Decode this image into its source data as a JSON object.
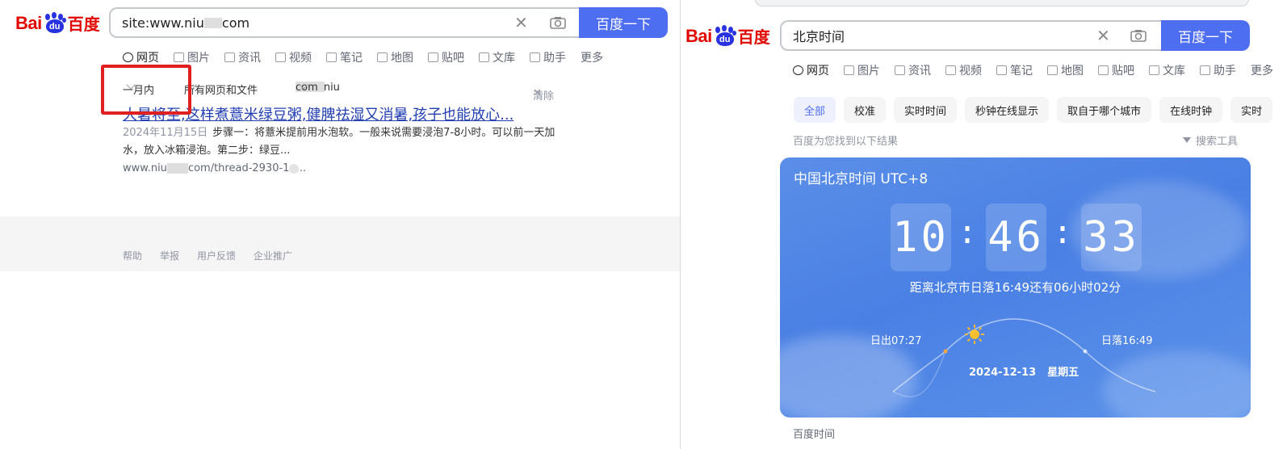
{
  "left": {
    "logo": {
      "latin": "Bai",
      "paw": "du",
      "cn": "百度"
    },
    "search": {
      "query": "site:www.niu",
      "query_tail": "com",
      "button": "百度一下"
    },
    "tabs": [
      "网页",
      "图片",
      "资讯",
      "视频",
      "笔记",
      "地图",
      "贴吧",
      "文库",
      "助手",
      "更多"
    ],
    "filters": {
      "time": "一月内",
      "scope": "所有网页和文件",
      "site": "www.niu",
      "site_tail": "com",
      "clear": "清除"
    },
    "result": {
      "title": "大暑将至,这样煮薏米绿豆粥,健脾祛湿又消暑,孩子也能放心...",
      "date": "2024年11月15日",
      "snippet": "步骤一：将薏米提前用水泡软。一般来说需要浸泡7-8小时。可以前一天加水，放入冰箱浸泡。第二步：绿豆...",
      "url_head": "www.niu",
      "url_tail": "com/thread-2930-1....."
    },
    "footer": [
      "帮助",
      "举报",
      "用户反馈",
      "企业推广"
    ]
  },
  "right": {
    "logo": {
      "latin": "Bai",
      "paw": "du",
      "cn": "百度"
    },
    "search": {
      "query": "北京时间",
      "button": "百度一下"
    },
    "tabs": [
      "网页",
      "图片",
      "资讯",
      "视频",
      "笔记",
      "地图",
      "贴吧",
      "文库",
      "助手",
      "更多"
    ],
    "chips": [
      "全部",
      "校准",
      "实时时间",
      "秒钟在线显示",
      "取自于哪个城市",
      "在线时钟",
      "实时"
    ],
    "found_text": "百度为您找到以下结果",
    "tools": "搜索工具",
    "card": {
      "title": "中国北京时间 UTC+8",
      "hours": "10",
      "minutes": "46",
      "seconds": "33",
      "sunset_countdown": "距离北京市日落16:49还有06小时02分",
      "sunrise": "日出07:27",
      "sunset": "日落16:49",
      "date": "2024-12-13",
      "weekday": "星期五"
    },
    "caption": "百度时间"
  },
  "colors": {
    "brand_blue": "#4e6ef2",
    "logo_red": "#e10601",
    "paw_blue": "#2932e1",
    "link_blue": "#2440b3",
    "highlight_red": "#e02020"
  }
}
